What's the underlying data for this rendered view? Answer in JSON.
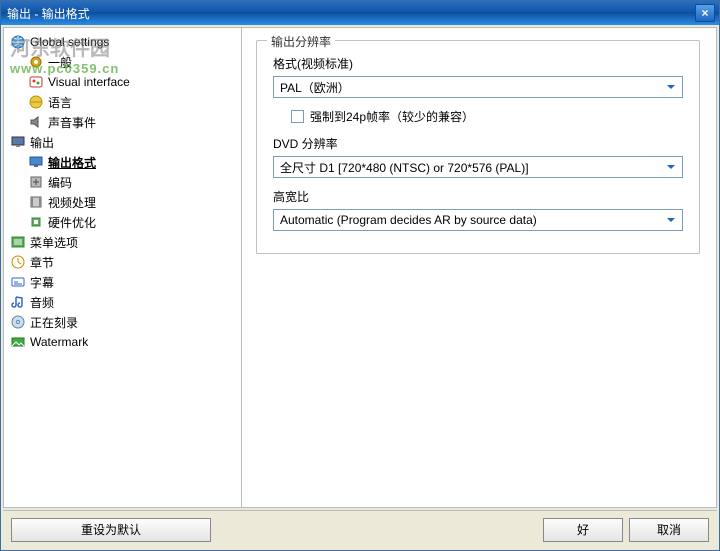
{
  "window": {
    "title": "输出 - 输出格式",
    "close": "×"
  },
  "watermark": {
    "line1": "河东软件园",
    "line2": "www.pc0359.cn"
  },
  "tree": {
    "global": "Global settings",
    "general": "一般",
    "visual": "Visual interface",
    "language": "语言",
    "sound": "声音事件",
    "output": "输出",
    "outformat": "输出格式",
    "encode": "编码",
    "videoproc": "视频处理",
    "hwopt": "硬件优化",
    "menuopt": "菜单选项",
    "chapter": "章节",
    "subtitle": "字幕",
    "audio": "音频",
    "burning": "正在刻录",
    "wm": "Watermark"
  },
  "group": {
    "legend": "输出分辨率",
    "format_label": "格式(视频标准)",
    "format_value": "PAL（欧洲）",
    "force24p": "强制到24p帧率（较少的兼容）",
    "dvd_label": "DVD 分辨率",
    "dvd_value": "全尺寸 D1 [720*480 (NTSC) or 720*576 (PAL)]",
    "ar_label": "高宽比",
    "ar_value": "Automatic (Program decides AR by source data)"
  },
  "footer": {
    "reset": "重设为默认",
    "ok": "好",
    "cancel": "取消"
  },
  "colors": {
    "dropdown_arrow": "#1a66c2"
  }
}
